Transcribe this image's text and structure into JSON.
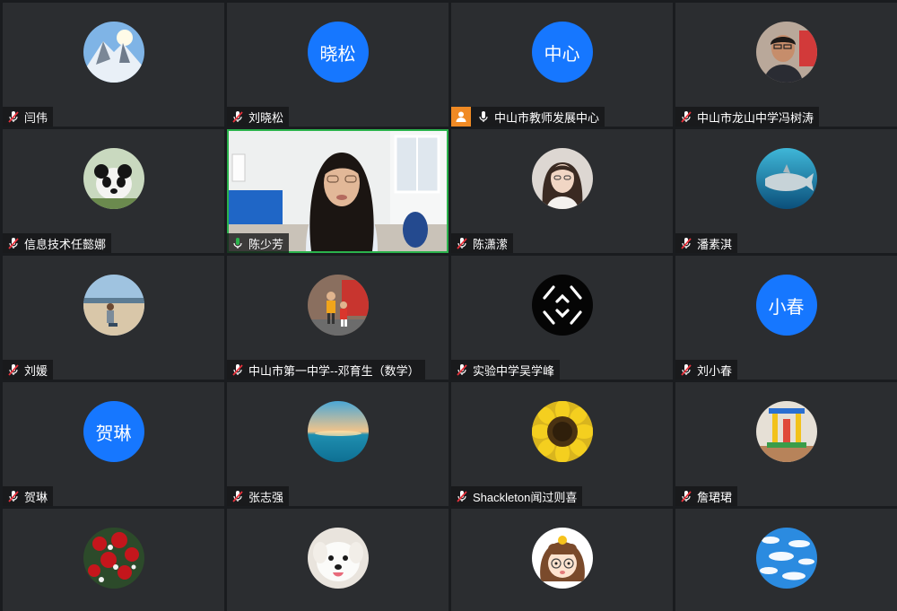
{
  "participants": [
    {
      "name": "闫伟",
      "avatar": "mountain-photo",
      "mic": "muted"
    },
    {
      "name": "刘晓松",
      "avatar_text": "晓松",
      "mic": "muted"
    },
    {
      "name": "中山市教师发展中心",
      "avatar_text": "中心",
      "mic": "unmuted",
      "host": true
    },
    {
      "name": "中山市龙山中学冯树涛",
      "avatar": "man-photo",
      "mic": "muted"
    },
    {
      "name": "信息技术任懿娜",
      "avatar": "panda-photo",
      "mic": "muted"
    },
    {
      "name": "陈少芳",
      "video": "live-camera",
      "mic": "speaking"
    },
    {
      "name": "陈潇潆",
      "avatar": "woman-photo",
      "mic": "muted"
    },
    {
      "name": "潘素淇",
      "avatar": "shark-photo",
      "mic": "muted"
    },
    {
      "name": "刘媛",
      "avatar": "beach-photo",
      "mic": "muted"
    },
    {
      "name": "中山市第一中学--邓育生（数学）",
      "avatar": "child-photo",
      "mic": "muted"
    },
    {
      "name": "实验中学吴学峰",
      "avatar": "logo-black",
      "mic": "muted"
    },
    {
      "name": "刘小春",
      "avatar_text": "小春",
      "mic": "muted"
    },
    {
      "name": "贺琳",
      "avatar_text": "贺琳",
      "mic": "muted"
    },
    {
      "name": "张志强",
      "avatar": "sea-sunset-photo",
      "mic": "muted"
    },
    {
      "name": "Shackleton闻过则喜",
      "avatar": "sunflower-photo",
      "mic": "muted"
    },
    {
      "name": "詹珺珺",
      "avatar": "toy-photo",
      "mic": "muted"
    },
    {
      "name": "",
      "avatar": "roses-photo",
      "mic": "none"
    },
    {
      "name": "",
      "avatar": "dog-photo",
      "mic": "none"
    },
    {
      "name": "",
      "avatar": "cartoon-girl",
      "mic": "none"
    },
    {
      "name": "",
      "avatar": "clouds-photo",
      "mic": "none"
    }
  ],
  "colors": {
    "avatar_blue": "#1677ff",
    "speaking_green": "#2bb24c",
    "muted_red": "#e8323c",
    "host_orange": "#f08a24"
  }
}
